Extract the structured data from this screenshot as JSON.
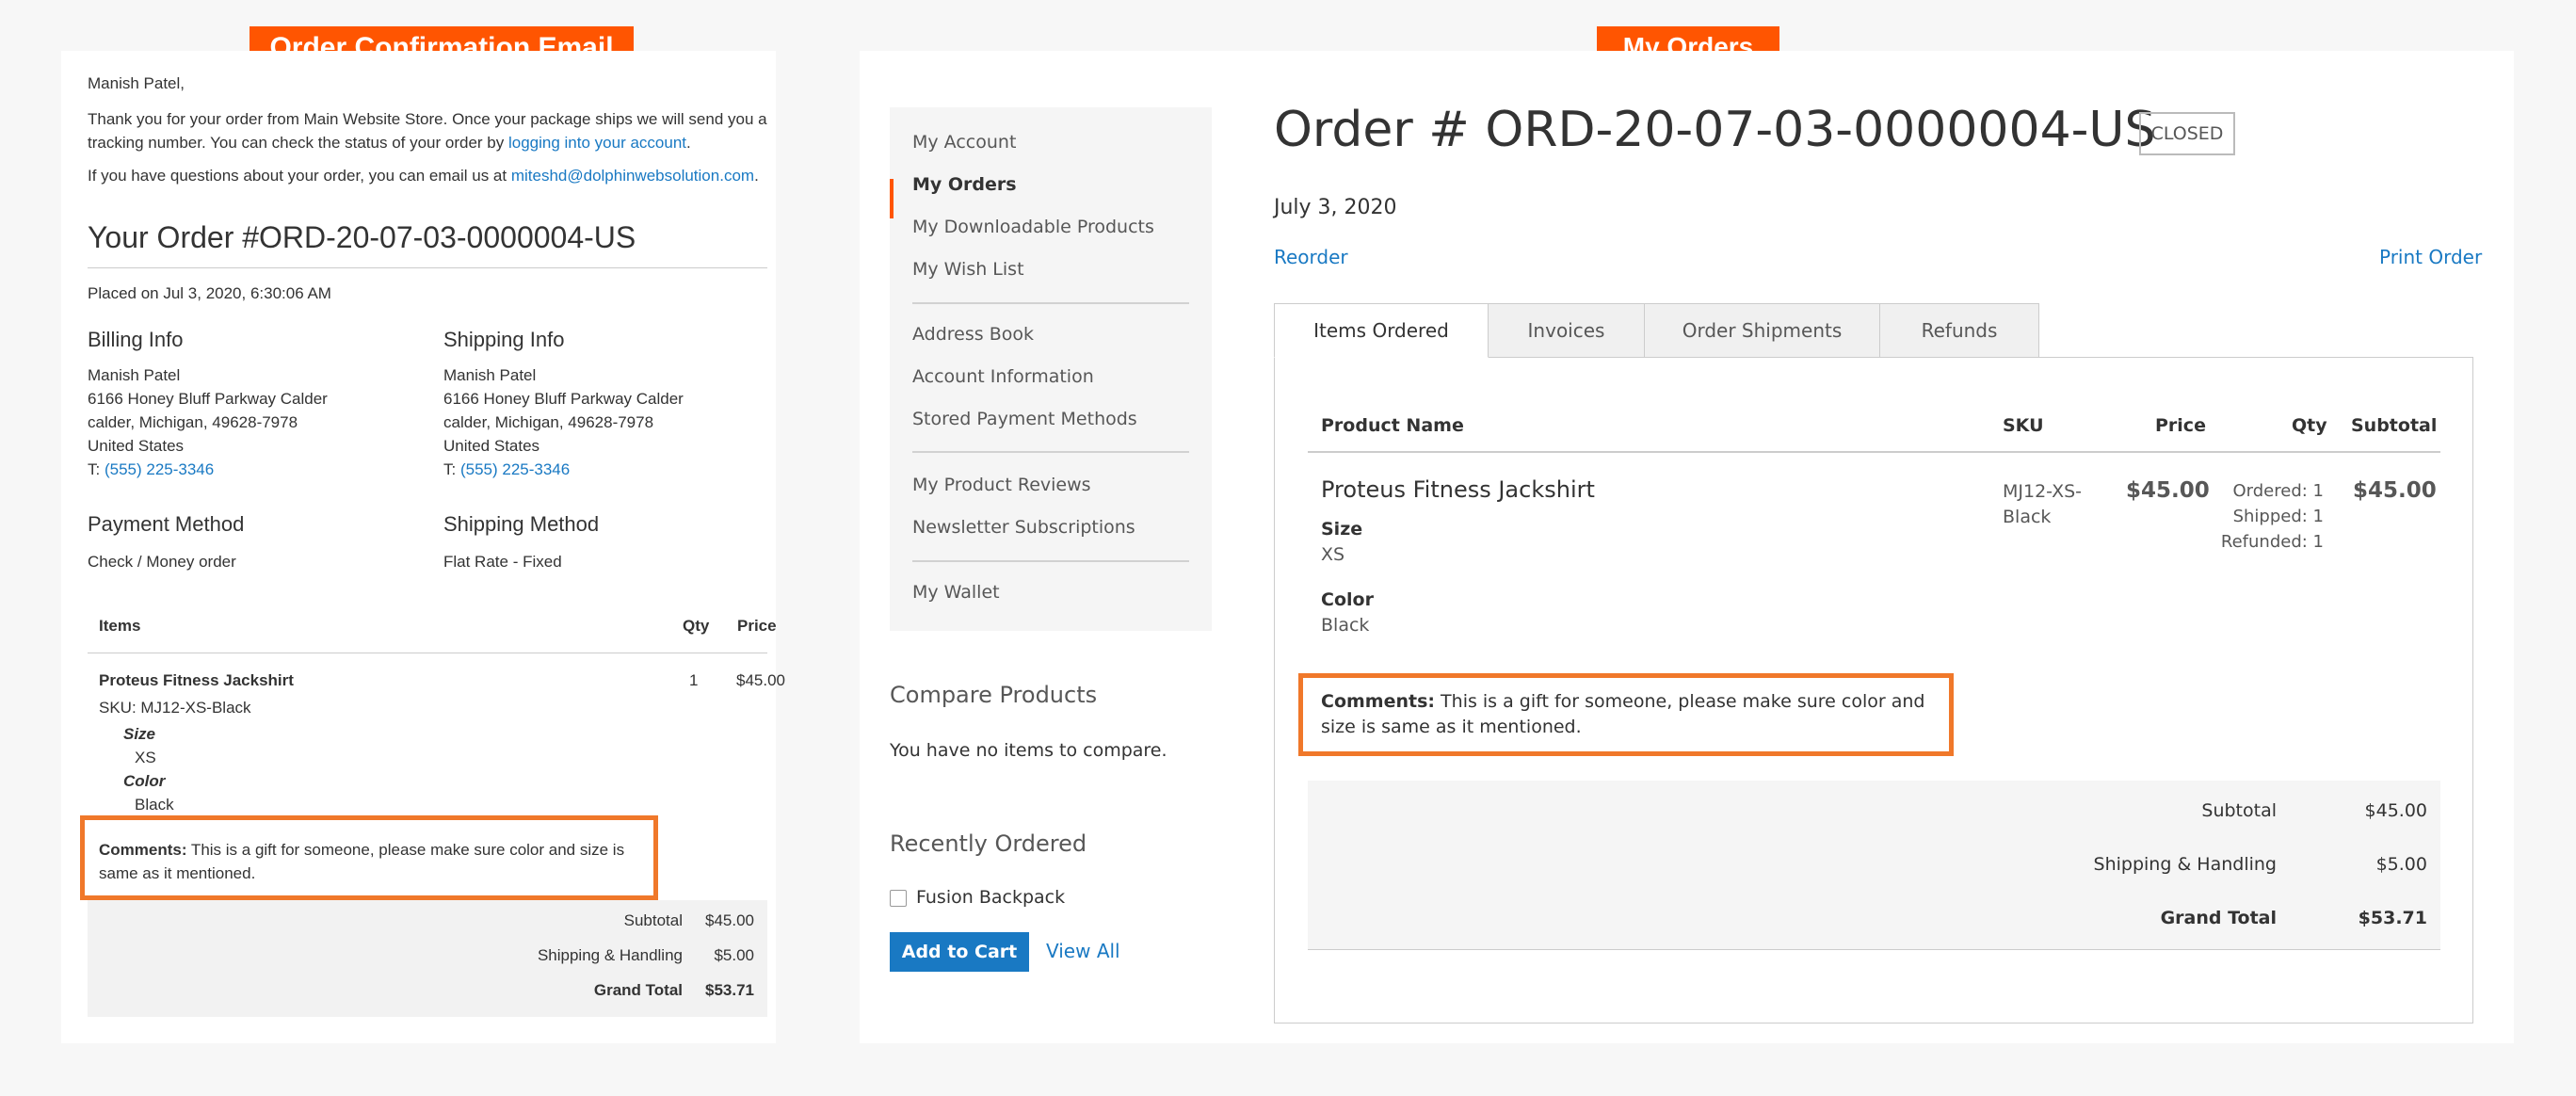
{
  "banners": {
    "email": "Order Confirmation Email",
    "orders": "My Orders"
  },
  "email": {
    "greeting": "Manish Patel,",
    "intro_before_link": "Thank you for your order from Main Website Store. Once your package ships we will send you a tracking number. You can check the status of your order by ",
    "intro_link": "logging into your account",
    "intro_after_link": ".",
    "questions_before": "If you have questions about your order, you can email us at ",
    "questions_email": "miteshd@dolphinwebsolution.com",
    "questions_after": ".",
    "order_title": "Your Order #ORD-20-07-03-0000004-US",
    "placed_on": "Placed on Jul 3, 2020, 6:30:06 AM",
    "billing": {
      "title": "Billing Info",
      "name": "Manish Patel",
      "street": "6166 Honey Bluff Parkway Calder",
      "city": "calder, Michigan, 49628-7978",
      "country": "United States",
      "phone_label": "T: ",
      "phone": "(555) 225-3346"
    },
    "shipping": {
      "title": "Shipping Info",
      "name": "Manish Patel",
      "street": "6166 Honey Bluff Parkway Calder",
      "city": "calder, Michigan, 49628-7978",
      "country": "United States",
      "phone_label": "T: ",
      "phone": "(555) 225-3346"
    },
    "payment": {
      "title": "Payment Method",
      "value": "Check / Money order"
    },
    "shipping_method": {
      "title": "Shipping Method",
      "value": "Flat Rate - Fixed"
    },
    "table": {
      "headers": {
        "items": "Items",
        "qty": "Qty",
        "price": "Price"
      },
      "item": {
        "name": "Proteus Fitness Jackshirt",
        "sku": "SKU: MJ12-XS-Black",
        "size_label": "Size",
        "size": "XS",
        "color_label": "Color",
        "color": "Black",
        "qty": "1",
        "price": "$45.00"
      }
    },
    "comment_label": "Comments:",
    "comment_text": " This is a gift for someone, please make sure color and size is same as it mentioned.",
    "totals": {
      "subtotal_label": "Subtotal",
      "subtotal": "$45.00",
      "shipping_label": "Shipping & Handling",
      "shipping": "$5.00",
      "grand_label": "Grand Total",
      "grand": "$53.71"
    }
  },
  "orders": {
    "sidebar": {
      "group1": [
        "My Account",
        "My Orders",
        "My Downloadable Products",
        "My Wish List"
      ],
      "group2": [
        "Address Book",
        "Account Information",
        "Stored Payment Methods"
      ],
      "group3": [
        "My Product Reviews",
        "Newsletter Subscriptions"
      ],
      "group4": [
        "My Wallet"
      ]
    },
    "compare": {
      "title": "Compare Products",
      "text": "You have no items to compare."
    },
    "recent": {
      "title": "Recently Ordered",
      "item": "Fusion Backpack",
      "add_to_cart": "Add to Cart",
      "view_all": "View All"
    },
    "order_title": "Order # ORD-20-07-03-0000004-US",
    "status": "CLOSED",
    "date": "July 3, 2020",
    "reorder": "Reorder",
    "print": "Print Order",
    "tabs": [
      "Items Ordered",
      "Invoices",
      "Order Shipments",
      "Refunds"
    ],
    "table": {
      "headers": {
        "product": "Product Name",
        "sku": "SKU",
        "price": "Price",
        "qty": "Qty",
        "subtotal": "Subtotal"
      },
      "item": {
        "name": "Proteus Fitness Jackshirt",
        "size_label": "Size",
        "size": "XS",
        "color_label": "Color",
        "color": "Black",
        "sku_line1": "MJ12-XS-",
        "sku_line2": "Black",
        "price": "$45.00",
        "ordered": "Ordered: 1",
        "shipped": "Shipped: 1",
        "refunded": "Refunded: 1",
        "subtotal": "$45.00"
      }
    },
    "comment_label": "Comments:",
    "comment_text": " This is a gift for someone, please make sure color and size is same as it mentioned.",
    "totals": {
      "subtotal_label": "Subtotal",
      "subtotal": "$45.00",
      "shipping_label": "Shipping & Handling",
      "shipping": "$5.00",
      "grand_label": "Grand Total",
      "grand": "$53.71"
    }
  },
  "colors": {
    "accent": "#ff5501",
    "highlight": "#f0782a",
    "link": "#1979c3"
  }
}
